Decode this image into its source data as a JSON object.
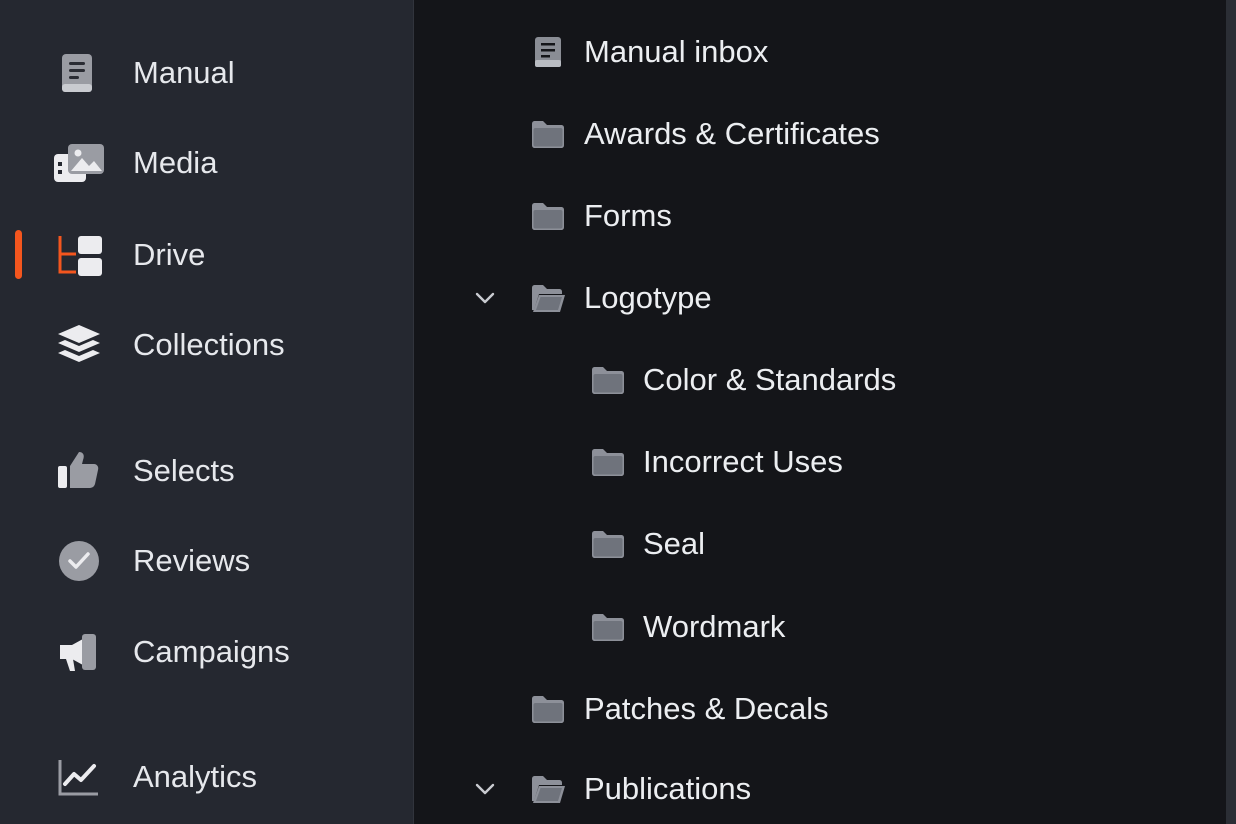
{
  "sidebar": {
    "active_item": "Drive",
    "active_color": "#f4561e",
    "items": [
      {
        "label": "Manual",
        "icon": "book-icon"
      },
      {
        "label": "Media",
        "icon": "images-icon"
      },
      {
        "label": "Drive",
        "icon": "folder-tree-icon"
      },
      {
        "label": "Collections",
        "icon": "layers-icon"
      },
      {
        "label": "Selects",
        "icon": "thumbs-up-icon"
      },
      {
        "label": "Reviews",
        "icon": "check-circle-icon"
      },
      {
        "label": "Campaigns",
        "icon": "megaphone-icon"
      },
      {
        "label": "Analytics",
        "icon": "chart-line-icon"
      }
    ]
  },
  "tree": {
    "items": [
      {
        "label": "Manual inbox",
        "icon": "book-icon",
        "level": 0
      },
      {
        "label": "Awards & Certificates",
        "icon": "folder-icon",
        "level": 0
      },
      {
        "label": "Forms",
        "icon": "folder-icon",
        "level": 0
      },
      {
        "label": "Logotype",
        "icon": "folder-open-icon",
        "level": 0,
        "expanded": true
      },
      {
        "label": "Color & Standards",
        "icon": "folder-icon",
        "level": 1
      },
      {
        "label": "Incorrect Uses",
        "icon": "folder-icon",
        "level": 1
      },
      {
        "label": "Seal",
        "icon": "folder-icon",
        "level": 1
      },
      {
        "label": "Wordmark",
        "icon": "folder-icon",
        "level": 1
      },
      {
        "label": "Patches & Decals",
        "icon": "folder-icon",
        "level": 0
      },
      {
        "label": "Publications",
        "icon": "folder-open-icon",
        "level": 0,
        "expanded": true
      }
    ]
  }
}
